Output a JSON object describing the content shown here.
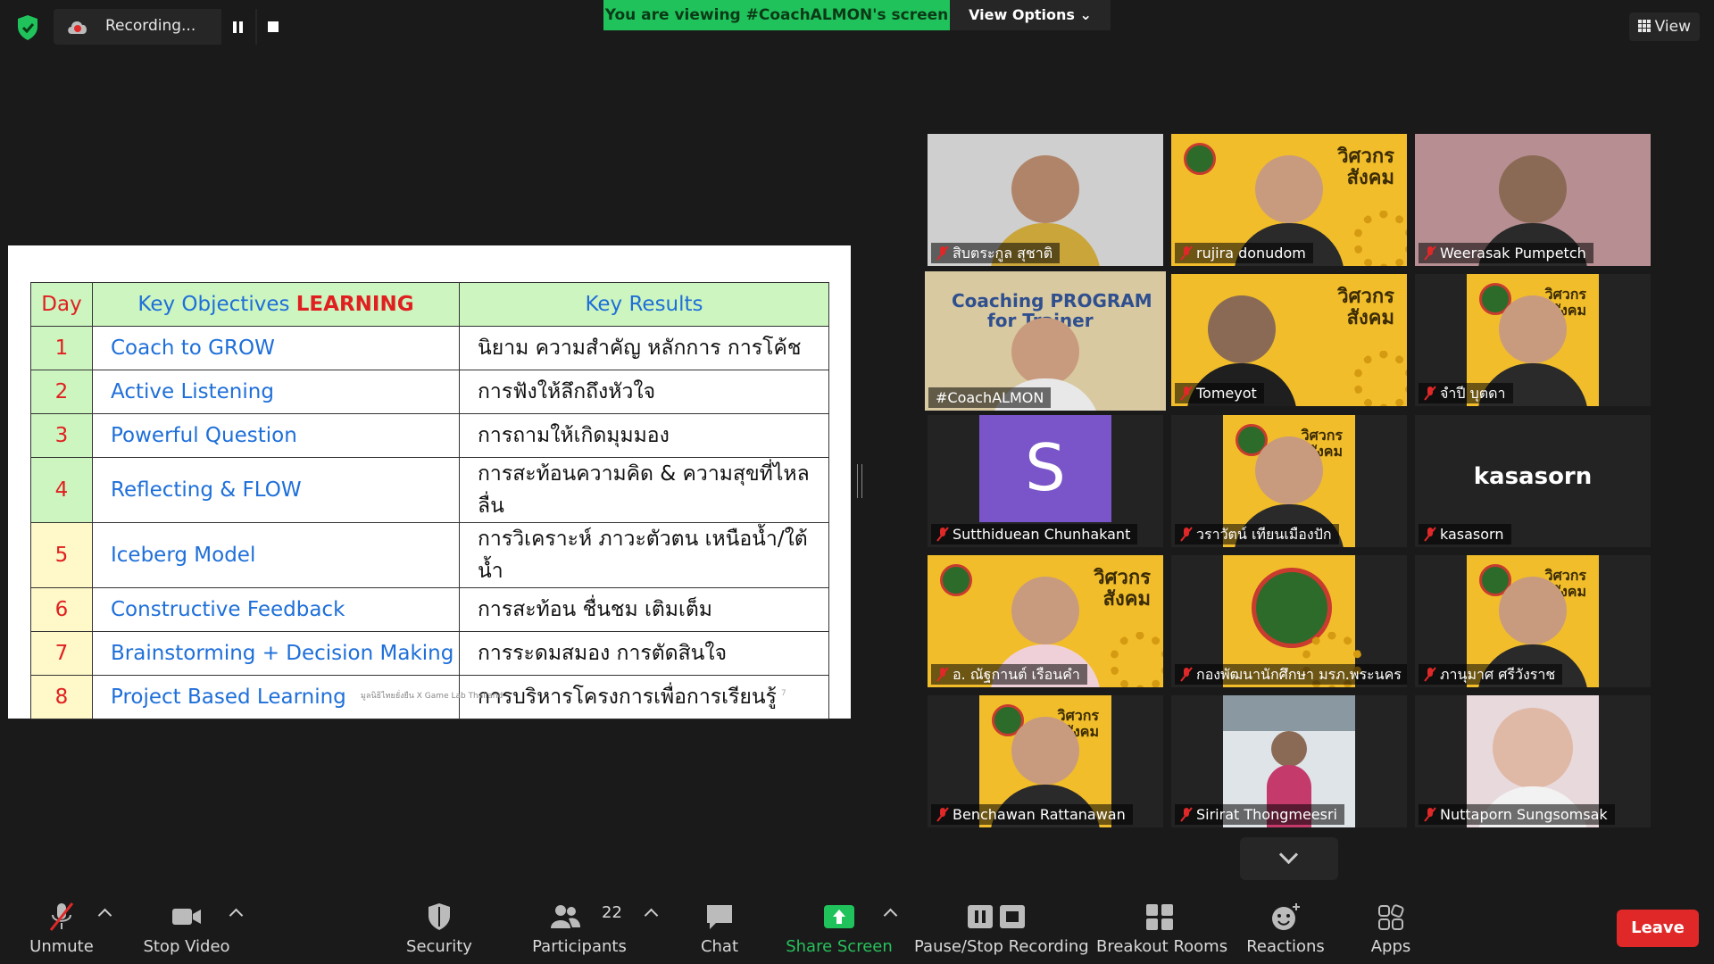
{
  "top_bar": {
    "recording_label": "Recording...",
    "viewing_banner": "You are viewing #CoachALMON's screen",
    "view_options": "View Options ⌄",
    "view_button": "View"
  },
  "slide": {
    "headers": {
      "day": "Day",
      "objectives_prefix": "Key Objectives ",
      "objectives_emph": "LEARNING",
      "results": "Key Results"
    },
    "rows": [
      {
        "day": "1",
        "objective": "Coach to GROW",
        "result": "นิยาม ความสำคัญ หลักการ การโค้ช"
      },
      {
        "day": "2",
        "objective": "Active Listening",
        "result": "การฟังให้ลึกถึงหัวใจ"
      },
      {
        "day": "3",
        "objective": "Powerful Question",
        "result": "การถามให้เกิดมุมมอง"
      },
      {
        "day": "4",
        "objective": "Reflecting & FLOW",
        "result": "การสะท้อนความคิด & ความสุขที่ไหลลื่น"
      },
      {
        "day": "5",
        "objective": "Iceberg Model",
        "result": "การวิเคราะห์ ภาวะตัวตน เหนือน้ำ/ใต้น้ำ"
      },
      {
        "day": "6",
        "objective": "Constructive Feedback",
        "result": "การสะท้อน ชื่นชม เติมเต็ม"
      },
      {
        "day": "7",
        "objective": "Brainstorming + Decision Making",
        "result": "การระดมสมอง การตัดสินใจ"
      },
      {
        "day": "8",
        "objective": "Project Based Learning",
        "result": "การบริหารโครงการเพื่อการเรียนรู้"
      }
    ],
    "footer": "มูลนิธิไทยยั่งยืน X Game Lab Thailand",
    "page_number": "7"
  },
  "participants": [
    {
      "name": "สิบตระกูล สุชาติ"
    },
    {
      "name": "rujira donudom"
    },
    {
      "name": "Weerasak Pumpetch"
    },
    {
      "name": "#CoachALMON"
    },
    {
      "name": "Tomeyot"
    },
    {
      "name": "จำปี บุตดา"
    },
    {
      "name": "Sutthiduean Chunhakant",
      "avatar_letter": "S"
    },
    {
      "name": "วราวัตน์ เทียนเมืองปัก"
    },
    {
      "name": "kasasorn",
      "display_text": "kasasorn"
    },
    {
      "name": "อ. ณัฐกานต์ เรือนคำ"
    },
    {
      "name": "กองพัฒนานักศึกษา มรภ.พระนคร"
    },
    {
      "name": "ภานุมาศ ศรีวังราช"
    },
    {
      "name": "Benchawan Rattanawan"
    },
    {
      "name": "Sirirat Thongmeesri"
    },
    {
      "name": "Nuttaporn Sungsomsak"
    }
  ],
  "coach_slide_text": {
    "line1": "Coaching PROGRAM",
    "line2": "for Trainer"
  },
  "banner_brand": {
    "line1": "วิศวกร",
    "line2": "สังคม"
  },
  "toolbar": {
    "unmute": "Unmute",
    "stop_video": "Stop Video",
    "security": "Security",
    "participants": "Participants",
    "participants_count": "22",
    "chat": "Chat",
    "share_screen": "Share Screen",
    "pause_stop_recording": "Pause/Stop Recording",
    "breakout_rooms": "Breakout Rooms",
    "reactions": "Reactions",
    "apps": "Apps",
    "leave": "Leave"
  },
  "colors": {
    "accent_green": "#20c35b",
    "leave_red": "#e02828",
    "banner_yellow": "#f2bd2a",
    "active_speaker": "#f3df4a"
  }
}
